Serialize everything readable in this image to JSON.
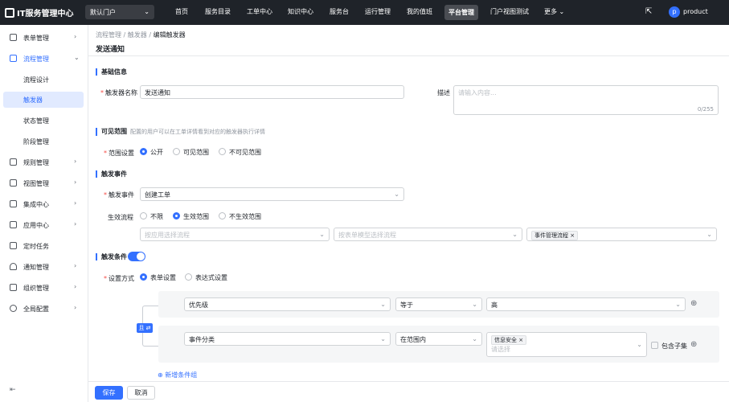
{
  "app": {
    "title": "IT服务管理中心",
    "portal": "默认门户"
  },
  "topnav": [
    "首页",
    "服务目录",
    "工单中心",
    "知识中心",
    "服务台",
    "运行管理",
    "我的值班",
    "平台管理",
    "门户视图测试",
    "更多"
  ],
  "topnav_active": "平台管理",
  "user": {
    "avatar": "p",
    "name": "product"
  },
  "sidebar": {
    "items": [
      {
        "label": "表单管理"
      },
      {
        "label": "流程管理"
      },
      {
        "label": "流程设计"
      },
      {
        "label": "触发器"
      },
      {
        "label": "状态管理"
      },
      {
        "label": "阶段管理"
      },
      {
        "label": "规则管理"
      },
      {
        "label": "视图管理"
      },
      {
        "label": "集成中心"
      },
      {
        "label": "应用中心"
      },
      {
        "label": "定时任务"
      },
      {
        "label": "通知管理"
      },
      {
        "label": "组织管理"
      },
      {
        "label": "全局配置"
      }
    ],
    "collapse_icon": "collapse-icon"
  },
  "breadcrumb": {
    "items": [
      "流程管理",
      "触发器",
      "编辑触发器"
    ],
    "sep": "/"
  },
  "page_title": "发送通知",
  "basic": {
    "section": "基础信息",
    "name_label": "触发器名称",
    "name_value": "发送通知",
    "desc_label": "描述",
    "desc_placeholder": "请输入内容...",
    "desc_counter": "0/255"
  },
  "scope": {
    "section": "可见范围",
    "hint": "配置的用户可以在工单详情看到对应的触发器执行详情",
    "label": "范围设置",
    "options": [
      "公开",
      "可见范围",
      "不可见范围"
    ],
    "selected": "公开"
  },
  "event": {
    "section": "触发事件",
    "label": "触发事件",
    "value": "创建工单",
    "flow_label": "生效流程",
    "flow_options": [
      "不限",
      "生效范围",
      "不生效范围"
    ],
    "flow_selected": "生效范围",
    "app_placeholder": "按应用选择流程",
    "model_placeholder": "按表单模型选择流程",
    "process_tag": "事件管理流程"
  },
  "condition": {
    "section": "触发条件",
    "toggle_on": true,
    "mode_label": "设置方式",
    "mode_options": [
      "表单设置",
      "表达式设置"
    ],
    "mode_selected": "表单设置",
    "logic": "且",
    "rows": [
      {
        "field": "优先级",
        "op": "等于",
        "value": "高"
      },
      {
        "field": "事件分类",
        "op": "在范围内",
        "value_tag": "信息安全",
        "value_placeholder": "请选择",
        "include_children": "包含子集"
      }
    ],
    "add_group": "新增条件组"
  },
  "footer": {
    "save": "保存",
    "cancel": "取消"
  },
  "colors": {
    "accent": "#3370ff",
    "topbar": "#1f2329",
    "required": "#f54a45"
  }
}
